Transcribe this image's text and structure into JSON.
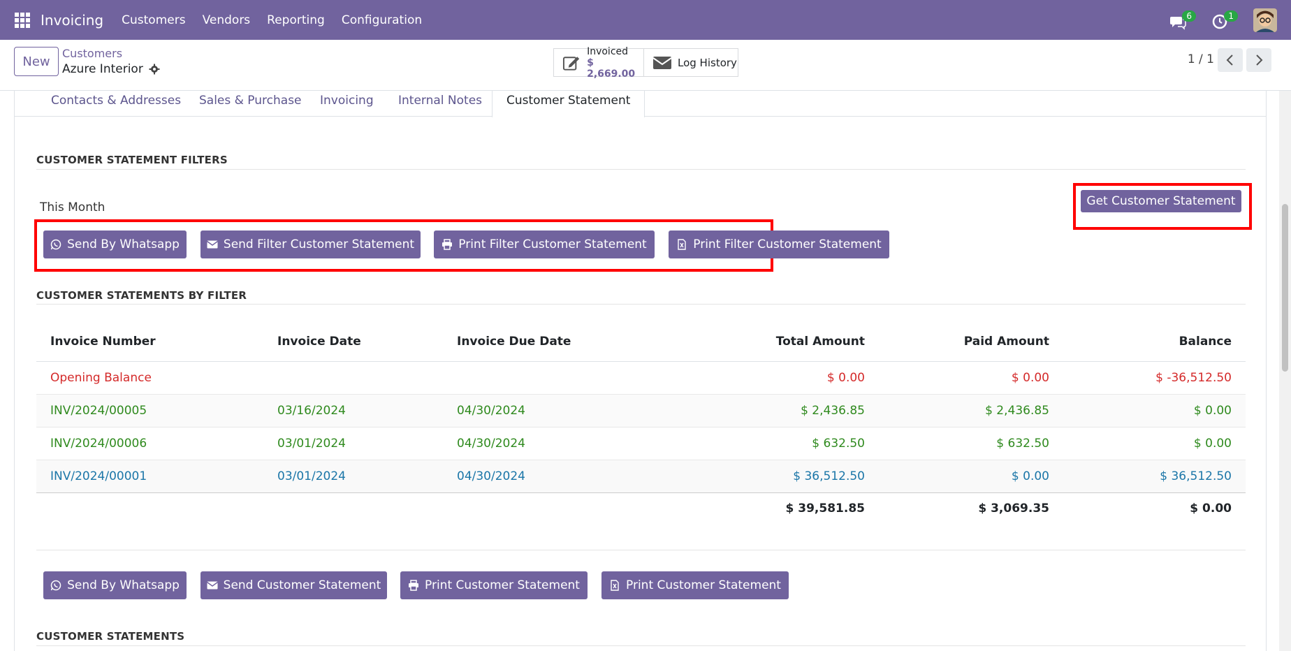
{
  "navbar": {
    "app_name": "Invoicing",
    "menu": [
      "Customers",
      "Vendors",
      "Reporting",
      "Configuration"
    ],
    "messages_count": "6",
    "activities_count": "1"
  },
  "control_panel": {
    "new_label": "New",
    "breadcrumb_parent": "Customers",
    "breadcrumb_current": "Azure Interior",
    "invoiced_label": "Invoiced",
    "invoiced_value": "$ 2,669.00",
    "log_history_label": "Log History",
    "pager": "1 / 1"
  },
  "tabs": {
    "contacts": "Contacts & Addresses",
    "sales": "Sales & Purchase",
    "invoicing": "Invoicing",
    "notes": "Internal Notes",
    "statement": "Customer Statement"
  },
  "filters": {
    "title": "CUSTOMER STATEMENT FILTERS",
    "period": "This Month",
    "get_button": "Get Customer Statement",
    "whatsapp_button": "Send By Whatsapp",
    "send_button": "Send Filter Customer Statement",
    "print_pdf_button": "Print Filter Customer Statement",
    "print_xls_button": "Print Filter Customer Statement"
  },
  "by_filter": {
    "title": "CUSTOMER STATEMENTS BY FILTER",
    "columns": [
      "Invoice Number",
      "Invoice Date",
      "Invoice Due Date",
      "Total Amount",
      "Paid Amount",
      "Balance"
    ],
    "rows": [
      [
        "Opening Balance",
        "",
        "",
        "$ 0.00",
        "$ 0.00",
        "$ -36,512.50"
      ],
      [
        "INV/2024/00005",
        "03/16/2024",
        "04/30/2024",
        "$ 2,436.85",
        "$ 2,436.85",
        "$ 0.00"
      ],
      [
        "INV/2024/00006",
        "03/01/2024",
        "04/30/2024",
        "$ 632.50",
        "$ 632.50",
        "$ 0.00"
      ],
      [
        "INV/2024/00001",
        "03/01/2024",
        "04/30/2024",
        "$ 36,512.50",
        "$ 0.00",
        "$ 36,512.50"
      ]
    ],
    "totals": [
      "$ 39,581.85",
      "$ 3,069.35",
      "$ 0.00"
    ]
  },
  "statement_actions": {
    "whatsapp_button": "Send By Whatsapp",
    "send_button": "Send Customer Statement",
    "print_pdf_button": "Print Customer Statement",
    "print_xls_button": "Print Customer Statement"
  },
  "statements": {
    "title": "CUSTOMER STATEMENTS"
  },
  "colors": {
    "brand": "#71639e",
    "highlight": "#ff0000",
    "overdue": "#d42a2a",
    "paid": "#2f8a1e",
    "unpaid": "#1b76a8"
  }
}
